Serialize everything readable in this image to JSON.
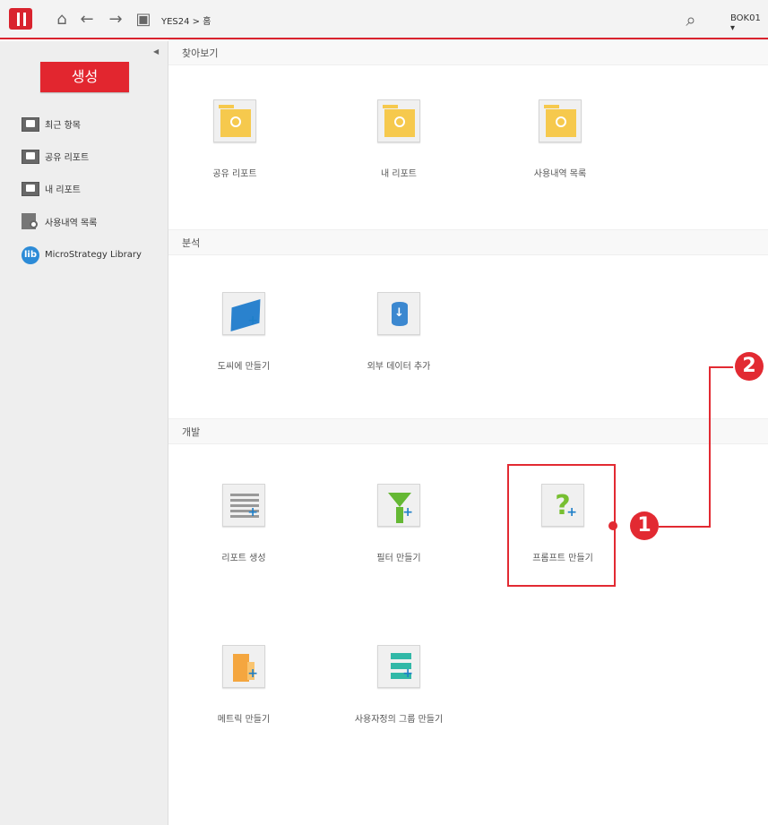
{
  "topbar": {
    "breadcrumb": "YES24 > 홈",
    "user": "BOK01 ▾"
  },
  "sidebar": {
    "create_button": "생성",
    "items": [
      {
        "label": "최근 항목",
        "icon": "recent-folder-icon"
      },
      {
        "label": "공유 리포트",
        "icon": "shared-folder-icon"
      },
      {
        "label": "내 리포트",
        "icon": "my-folder-icon"
      },
      {
        "label": "사용내역 목록",
        "icon": "history-icon"
      },
      {
        "label": "MicroStrategy Library",
        "icon": "library-icon"
      }
    ]
  },
  "sections": [
    {
      "title": "찾아보기",
      "tiles": [
        {
          "label": "공유 리포트",
          "icon": "shared-folder-icon"
        },
        {
          "label": "내 리포트",
          "icon": "my-folder-icon"
        },
        {
          "label": "사용내역 목록",
          "icon": "history-folder-icon"
        }
      ]
    },
    {
      "title": "분석",
      "tiles": [
        {
          "label": "도씨에 만들기",
          "icon": "dossier-create-icon"
        },
        {
          "label": "외부 데이터 추가",
          "icon": "external-data-icon"
        }
      ]
    },
    {
      "title": "개발",
      "tiles": [
        {
          "label": "리포트 생성",
          "icon": "report-create-icon"
        },
        {
          "label": "필터 만들기",
          "icon": "filter-create-icon"
        },
        {
          "label": "프롬프트 만들기",
          "icon": "prompt-create-icon"
        },
        {
          "label": "메트릭 만들기",
          "icon": "metric-create-icon"
        },
        {
          "label": "사용자정의 그룹 만들기",
          "icon": "custom-group-create-icon"
        }
      ]
    }
  ],
  "annotations": {
    "marker_1": "1",
    "marker_2": "2"
  },
  "colors": {
    "brand": "#d9232e",
    "sidebar": "#eeeeee",
    "section": "#f8f8f8"
  }
}
